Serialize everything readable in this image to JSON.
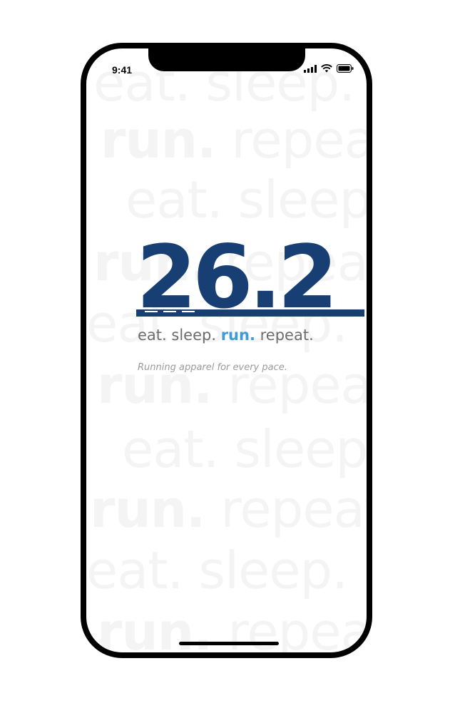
{
  "status_bar": {
    "time": "9:41",
    "icons": [
      "cellular-signal-icon",
      "wifi-icon",
      "battery-icon"
    ]
  },
  "background_pattern": [
    [
      "eat.",
      "sleep."
    ],
    [
      "run.",
      "repeat."
    ],
    [
      "eat.",
      "sleep."
    ],
    [
      "run.",
      "repeat."
    ],
    [
      "eat.",
      "sleep."
    ],
    [
      "run.",
      "repeat."
    ],
    [
      "eat.",
      "sleep."
    ],
    [
      "run.",
      "repeat."
    ],
    [
      "eat.",
      "sleep."
    ],
    [
      "run.",
      "repeat."
    ]
  ],
  "logo": {
    "number": "26.2",
    "tagline_eat": "eat.",
    "tagline_sleep": "sleep.",
    "tagline_run": "run.",
    "tagline_repeat": "repeat.",
    "subtitle": "Running apparel for every pace."
  },
  "colors": {
    "brand_navy": "#173f74",
    "accent_blue": "#3f9bd8",
    "tagline_gray": "#6c6c6c",
    "watermark_gray": "#f4f4f4"
  }
}
